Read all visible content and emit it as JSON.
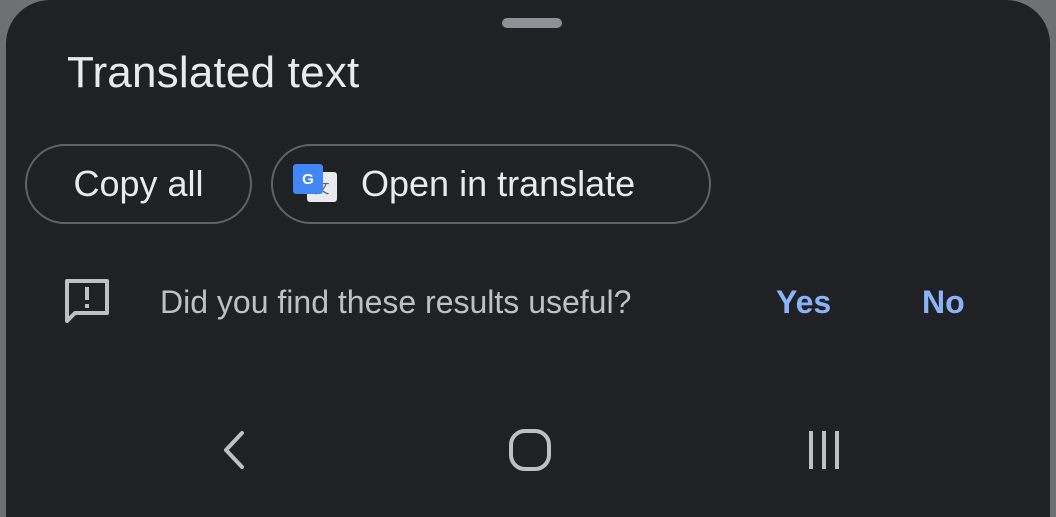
{
  "sheet": {
    "title": "Translated text",
    "actions": {
      "copy_all_label": "Copy all",
      "open_translate_label": "Open in translate",
      "translate_icon_letter_front": "G",
      "translate_icon_letter_back": "文"
    },
    "feedback": {
      "question": "Did you find these results useful?",
      "yes_label": "Yes",
      "no_label": "No",
      "icon": "feedback-icon"
    }
  },
  "navigation": {
    "back_icon": "back-icon",
    "home_icon": "home-icon",
    "recents_icon": "recents-icon"
  },
  "colors": {
    "sheet_background": "#202124",
    "primary_text": "#e8eaed",
    "secondary_text": "#bdc1c6",
    "accent": "#8ab4f8",
    "outline": "#5f6368",
    "translate_blue": "#4285f4"
  }
}
